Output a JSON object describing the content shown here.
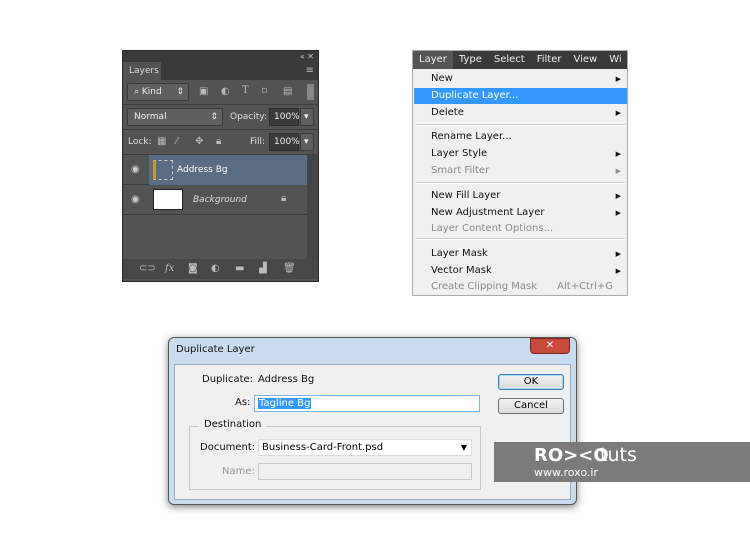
{
  "layers_panel": {
    "tab": "Layers",
    "filter": "Kind",
    "blend_mode": "Normal",
    "opacity_label": "Opacity:",
    "opacity": "100%",
    "lock_label": "Lock:",
    "fill_label": "Fill:",
    "fill": "100%",
    "layers": [
      {
        "name": "Address Bg",
        "selected": true
      },
      {
        "name": "Background",
        "locked": true
      }
    ]
  },
  "menu": {
    "bar": [
      "Layer",
      "Type",
      "Select",
      "Filter",
      "View",
      "Wi"
    ],
    "items": [
      {
        "label": "New",
        "sub": true
      },
      {
        "label": "Duplicate Layer...",
        "highlighted": true
      },
      {
        "label": "Delete",
        "sub": true
      },
      {
        "label": "Rename Layer..."
      },
      {
        "label": "Layer Style",
        "sub": true
      },
      {
        "label": "Smart Filter",
        "sub": true,
        "disabled": true
      },
      {
        "label": "New Fill Layer",
        "sub": true
      },
      {
        "label": "New Adjustment Layer",
        "sub": true
      },
      {
        "label": "Layer Content Options...",
        "disabled": true
      },
      {
        "label": "Layer Mask",
        "sub": true
      },
      {
        "label": "Vector Mask",
        "sub": true
      },
      {
        "label": "Create Clipping Mask",
        "shortcut": "Alt+Ctrl+G",
        "disabled": true
      }
    ]
  },
  "dialog": {
    "title": "Duplicate Layer",
    "duplicate_label": "Duplicate:",
    "duplicate_value": "Address Bg",
    "as_label": "As:",
    "as_value": "Tagline Bg",
    "destination": "Destination",
    "document_label": "Document:",
    "document_value": "Business-Card-Front.psd",
    "name_label": "Name:",
    "ok": "OK",
    "cancel": "Cancel",
    "close": "✕"
  },
  "watermark": {
    "brand": "RO><O",
    "suffix": "tuts",
    "url": "www.roxo.ir"
  }
}
